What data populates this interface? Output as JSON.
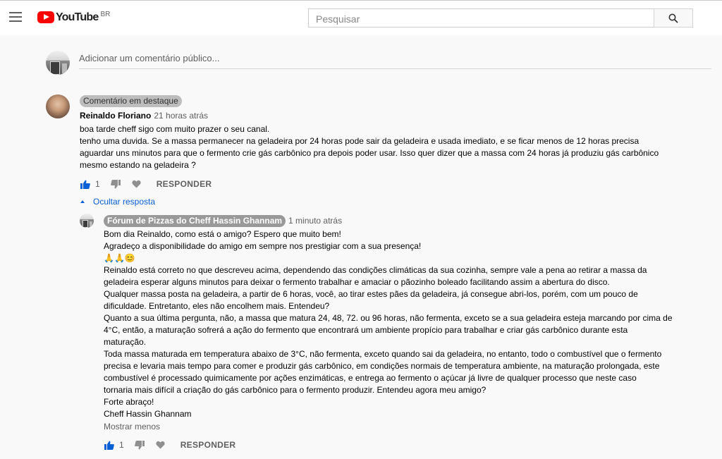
{
  "header": {
    "logo_text": "YouTube",
    "region": "BR",
    "search_placeholder": "Pesquisar"
  },
  "add_comment": {
    "placeholder": "Adicionar um comentário público..."
  },
  "pinned_comment": {
    "badge": "Comentário em destaque",
    "author": "Reinaldo Floriano",
    "time": "21 horas atrás",
    "lines": [
      "boa tarde cheff sigo com muito prazer o seu canal.",
      "tenho uma duvida. Se a massa permanecer na geladeira por 24 horas pode sair da geladeira e usada imediato, e se ficar menos de 12 horas precisa",
      "aguardar uns minutos para que o fermento crie gás carbônico pra depois poder usar. Isso quer dizer que a massa com 24 horas já produziu gás carbônico",
      "mesmo estando na geladeira ?"
    ],
    "likes": "1",
    "reply_label": "RESPONDER"
  },
  "toggle_replies": {
    "label": "Ocultar resposta"
  },
  "reply": {
    "author": "Fórum de Pizzas do Cheff Hassin Ghannam",
    "time": "1 minuto atrás",
    "lines": [
      "Bom dia Reinaldo, como está o amigo? Espero que muito bem!",
      "Agradeço a disponibilidade do amigo em sempre nos prestigiar com a sua presença!",
      "🙏🙏😊",
      "Reinaldo está correto no que descreveu acima, dependendo das condições climáticas da sua cozinha, sempre vale a pena ao retirar a massa da",
      "geladeira esperar alguns minutos para deixar o fermento trabalhar e amaciar o pãozinho boleado facilitando assim a abertura do disco.",
      "Qualquer massa posta na geladeira, a partir de 6 horas, você, ao tirar estes pães da geladeira, já consegue abri-los, porém, com um pouco de",
      "dificuldade. Entretanto, eles não encolhem mais. Entendeu?",
      "Quanto a sua última pergunta, não, a massa que matura 24, 48, 72. ou 96 horas, não fermenta, exceto se a sua geladeira esteja marcando por cima de",
      "4°C, então, a maturação sofrerá a ação do fermento que encontrará um ambiente propício para trabalhar e criar gás carbônico durante esta",
      "maturação.",
      "Toda massa maturada em temperatura abaixo de 3°C, não fermenta, exceto quando sai da geladeira, no entanto, todo o combustível que o fermento",
      "precisa e levaria mais tempo para comer e produzir gás carbônico, em condições normais de temperatura ambiente, na maturação prolongada, este",
      "combustível é processado quimicamente por ações enzimáticas, e entrega ao fermento o açúcar já livre de qualquer processo que neste caso",
      "tornaria mais difícil a criação do gás carbônico para o fermento produzir. Entendeu agora meu amigo?",
      "Forte abraço!",
      "Cheff Hassin Ghannam"
    ],
    "show_less": "Mostrar menos",
    "likes": "1",
    "reply_label": "RESPONDER"
  },
  "colors": {
    "brand_red": "#ff0000",
    "link_blue": "#065fd4",
    "like_blue": "#065fd4",
    "muted": "#606060"
  }
}
